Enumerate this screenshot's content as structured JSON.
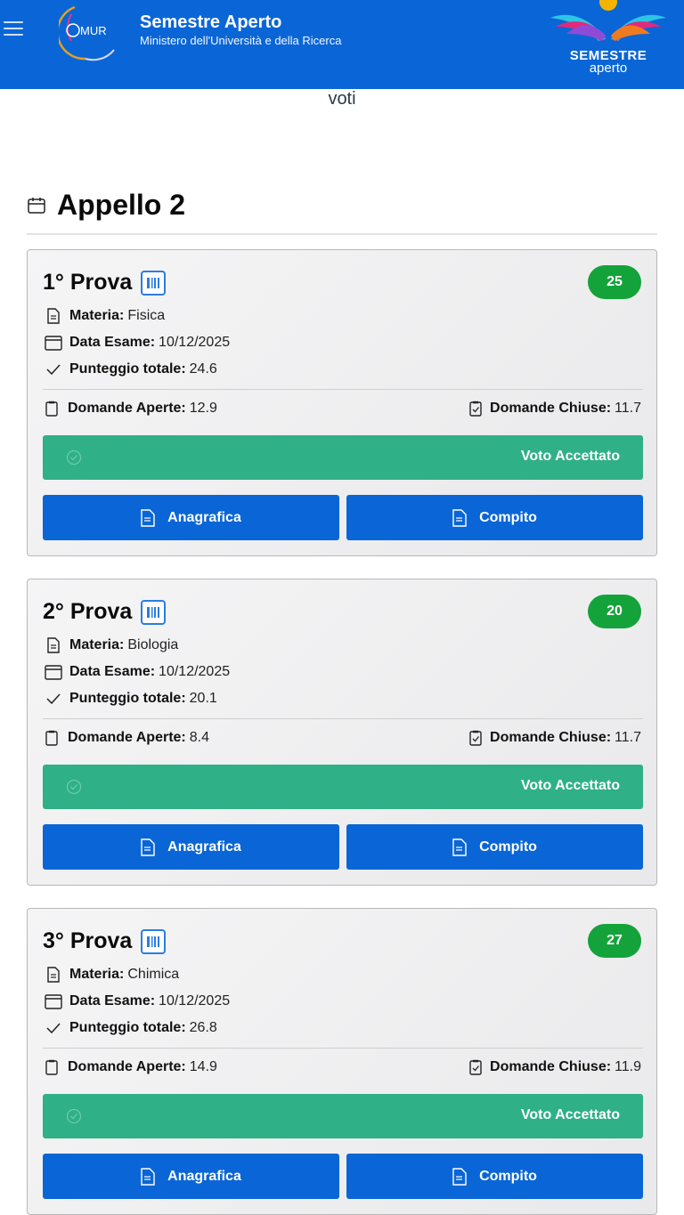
{
  "header": {
    "logo_text": "MUR",
    "title": "Semestre Aperto",
    "subtitle": "Ministero dell'Università e della Ricerca",
    "brand_title": "SEMESTRE",
    "brand_subtitle": "aperto"
  },
  "page": {
    "heading": "voti",
    "section_title": "Appello 2"
  },
  "labels": {
    "materia": "Materia:",
    "data_esame": "Data Esame:",
    "punteggio": "Punteggio totale:",
    "aperte": "Domande Aperte:",
    "chiuse": "Domande Chiuse:",
    "accepted": "Voto Accettato",
    "anagrafica": "Anagrafica",
    "compito": "Compito"
  },
  "cards": [
    {
      "title": "1° Prova",
      "score": "25",
      "materia": "Fisica",
      "data": "10/12/2025",
      "punteggio": "24.6",
      "aperte": "12.9",
      "chiuse": "11.7"
    },
    {
      "title": "2° Prova",
      "score": "20",
      "materia": "Biologia",
      "data": "10/12/2025",
      "punteggio": "20.1",
      "aperte": "8.4",
      "chiuse": "11.7"
    },
    {
      "title": "3° Prova",
      "score": "27",
      "materia": "Chimica",
      "data": "10/12/2025",
      "punteggio": "26.8",
      "aperte": "14.9",
      "chiuse": "11.9"
    }
  ],
  "colors": {
    "header": "#0a66d6",
    "badge": "#14a33a",
    "accepted": "#2fb087",
    "button": "#0a66d6"
  }
}
